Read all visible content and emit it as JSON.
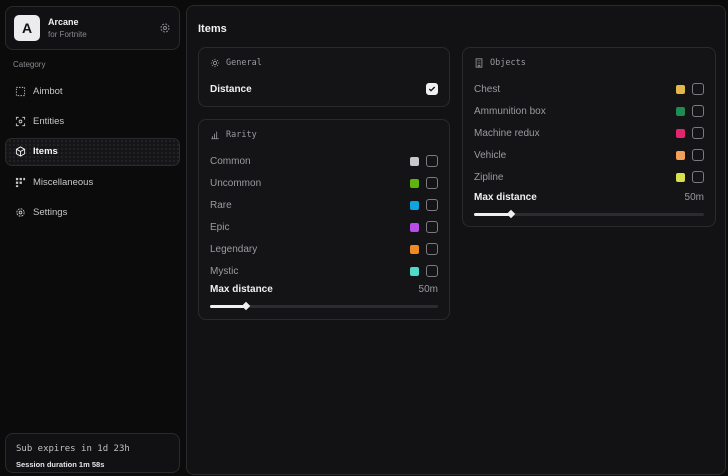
{
  "brand": {
    "logo_letter": "A",
    "title": "Arcane",
    "subtitle": "for Fortnite"
  },
  "sidebar": {
    "category_label": "Category",
    "items": [
      {
        "label": "Aimbot",
        "icon": "crosshair-icon",
        "active": false
      },
      {
        "label": "Entities",
        "icon": "scan-icon",
        "active": false
      },
      {
        "label": "Items",
        "icon": "box-icon",
        "active": true
      },
      {
        "label": "Miscellaneous",
        "icon": "grid-icon",
        "active": false
      },
      {
        "label": "Settings",
        "icon": "gear-icon",
        "active": false
      }
    ],
    "subscription": {
      "expires": "Sub expires in 1d 23h",
      "session": "Session duration 1m 58s"
    }
  },
  "main": {
    "title": "Items",
    "general": {
      "header": "General",
      "rows": [
        {
          "label": "Distance",
          "checked": true
        }
      ]
    },
    "rarity": {
      "header": "Rarity",
      "rows": [
        {
          "label": "Common",
          "color": "#c8c8cc",
          "checked": false
        },
        {
          "label": "Uncommon",
          "color": "#5fb30f",
          "checked": false
        },
        {
          "label": "Rare",
          "color": "#0fa3e0",
          "checked": false
        },
        {
          "label": "Epic",
          "color": "#b84ce6",
          "checked": false
        },
        {
          "label": "Legendary",
          "color": "#f08a24",
          "checked": false
        },
        {
          "label": "Mystic",
          "color": "#4fd9c8",
          "checked": false
        }
      ],
      "max_distance": {
        "label": "Max distance",
        "value": "50m",
        "fraction": 0.16
      }
    },
    "objects": {
      "header": "Objects",
      "rows": [
        {
          "label": "Chest",
          "color": "#e3b84a",
          "checked": false
        },
        {
          "label": "Ammunition box",
          "color": "#1f8a52",
          "checked": false
        },
        {
          "label": "Machine redux",
          "color": "#e0266e",
          "checked": false
        },
        {
          "label": "Vehicle",
          "color": "#f0a05a",
          "checked": false
        },
        {
          "label": "Zipline",
          "color": "#d8e04e",
          "checked": false
        }
      ],
      "max_distance": {
        "label": "Max distance",
        "value": "50m",
        "fraction": 0.16
      }
    }
  }
}
